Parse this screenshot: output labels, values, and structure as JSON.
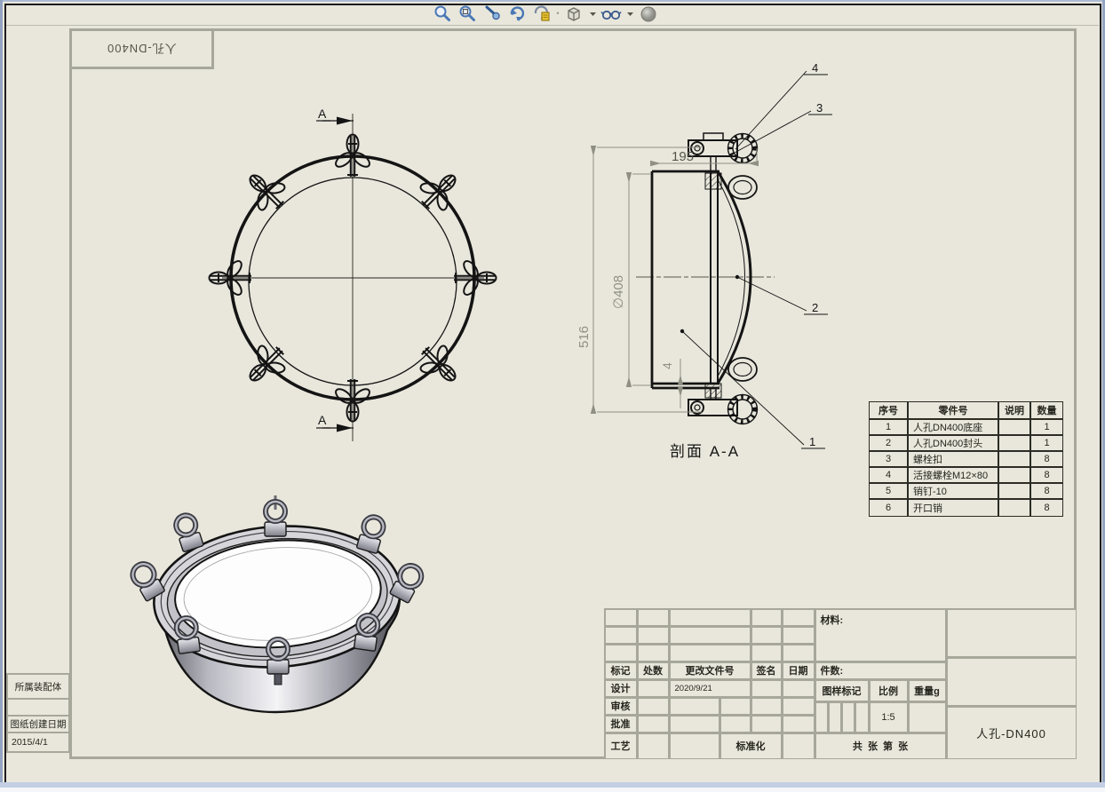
{
  "toolbar": {
    "icons": [
      "zoom-to-fit",
      "zoom-to-area",
      "previous-view",
      "rotate-view",
      "view-orientation",
      "display-style",
      "hide-show-items",
      "appearances"
    ]
  },
  "colors": {
    "paper": "#e9e7dc",
    "frame_gray": "#a7a79a",
    "line_black": "#1c1c1c",
    "dim_gray": "#8f8f83",
    "window_border": "#93a3c2",
    "icon_blue": "#4a78b5",
    "icon_yellow": "#e8c430"
  },
  "sheet": {
    "orientation_label": "人孔-DN400",
    "left_panel": {
      "assembly_label": "所属装配体",
      "created_label": "图纸创建日期",
      "created_value": "2015/4/1"
    },
    "section": {
      "label": "剖面 A-A",
      "arrow": "A"
    },
    "dims": {
      "height": "516",
      "dia": "∅408",
      "len": "195",
      "lip": "4"
    },
    "balloons": {
      "b1": "1",
      "b2": "2",
      "b3": "3",
      "b4": "4"
    },
    "bom": {
      "headers": [
        "序号",
        "零件号",
        "说明",
        "数量"
      ],
      "rows": [
        [
          "1",
          "人孔DN400底座",
          "",
          "1"
        ],
        [
          "2",
          "人孔DN400封头",
          "",
          "1"
        ],
        [
          "3",
          "螺栓扣",
          "",
          "8"
        ],
        [
          "4",
          "活接螺栓M12×80",
          "",
          "8"
        ],
        [
          "5",
          "销钉-10",
          "",
          "8"
        ],
        [
          "6",
          "开口销",
          "",
          "8"
        ]
      ]
    },
    "tb": {
      "mark": "标记",
      "qty": "处数",
      "doc": "更改文件号",
      "sign": "签名",
      "date": "日期",
      "design": "设计",
      "design_date": "2020/9/21",
      "check": "审核",
      "approve": "批准",
      "craft": "工艺",
      "std": "标准化",
      "material": "材料:",
      "pieces": "件数:",
      "dmark": "图样标记",
      "scale": "比例",
      "weight": "重量g",
      "scale_val": "1:5",
      "sheets": "共  张  第  张",
      "title": "人孔-DN400"
    }
  }
}
